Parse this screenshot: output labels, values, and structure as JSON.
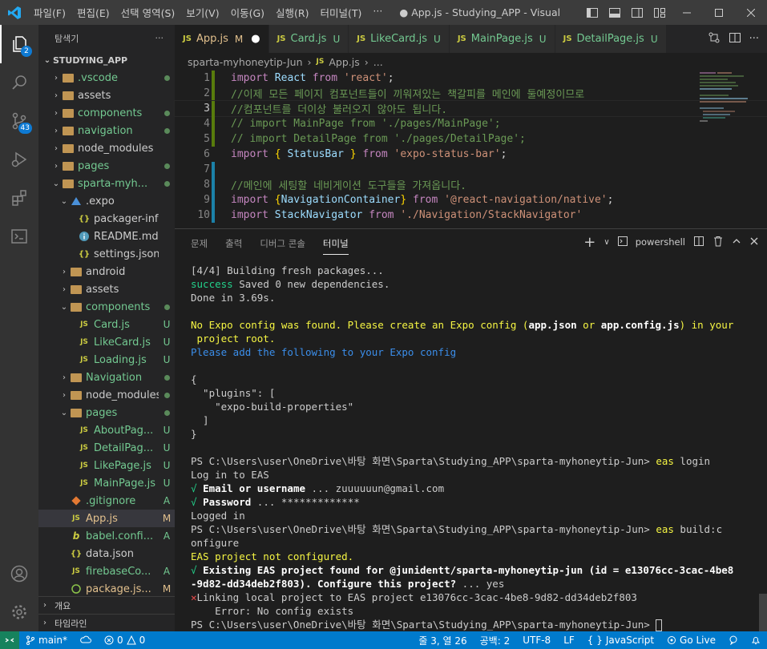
{
  "titlebar": {
    "menu": [
      "파일(F)",
      "편집(E)",
      "선택 영역(S)",
      "보기(V)",
      "이동(G)",
      "실행(R)",
      "터미널(T)",
      "···"
    ],
    "title": "● App.js - Studying_APP - Visual Studi..."
  },
  "activity": {
    "explorer_badge": "2",
    "scm_badge": "43"
  },
  "sidebar": {
    "header": "탐색기",
    "more": "···",
    "project": "STUDYING_APP",
    "items": [
      {
        "label": ".vscode",
        "indent": 1,
        "type": "folder",
        "chev": "›",
        "status": "dot",
        "color": "green"
      },
      {
        "label": "assets",
        "indent": 1,
        "type": "folder",
        "chev": "›",
        "status": "",
        "color": ""
      },
      {
        "label": "components",
        "indent": 1,
        "type": "folder",
        "chev": "›",
        "status": "dot",
        "color": "green"
      },
      {
        "label": "navigation",
        "indent": 1,
        "type": "folder",
        "chev": "›",
        "status": "dot",
        "color": "green"
      },
      {
        "label": "node_modules",
        "indent": 1,
        "type": "folder",
        "chev": "›",
        "status": "",
        "color": ""
      },
      {
        "label": "pages",
        "indent": 1,
        "type": "folder",
        "chev": "›",
        "status": "dot",
        "color": "green"
      },
      {
        "label": "sparta-myh...",
        "indent": 1,
        "type": "folder",
        "chev": "⌄",
        "status": "dot",
        "color": "green"
      },
      {
        "label": ".expo",
        "indent": 2,
        "type": "folder",
        "chev": "⌄",
        "status": "",
        "color": ""
      },
      {
        "label": "packager-info.j...",
        "indent": 3,
        "type": "json",
        "chev": "",
        "status": "",
        "color": ""
      },
      {
        "label": "README.md",
        "indent": 3,
        "type": "info",
        "chev": "",
        "status": "",
        "color": ""
      },
      {
        "label": "settings.json",
        "indent": 3,
        "type": "json",
        "chev": "",
        "status": "",
        "color": ""
      },
      {
        "label": "android",
        "indent": 2,
        "type": "folder",
        "chev": "›",
        "status": "",
        "color": ""
      },
      {
        "label": "assets",
        "indent": 2,
        "type": "folder",
        "chev": "›",
        "status": "",
        "color": ""
      },
      {
        "label": "components",
        "indent": 2,
        "type": "folder",
        "chev": "⌄",
        "status": "dot",
        "color": "green"
      },
      {
        "label": "Card.js",
        "indent": 3,
        "type": "js",
        "chev": "",
        "status": "U",
        "color": "green"
      },
      {
        "label": "LikeCard.js",
        "indent": 3,
        "type": "js",
        "chev": "",
        "status": "U",
        "color": "green"
      },
      {
        "label": "Loading.js",
        "indent": 3,
        "type": "js",
        "chev": "",
        "status": "U",
        "color": "green"
      },
      {
        "label": "Navigation",
        "indent": 2,
        "type": "folder",
        "chev": "›",
        "status": "dot",
        "color": "green"
      },
      {
        "label": "node_modules",
        "indent": 2,
        "type": "folder",
        "chev": "›",
        "status": "dot",
        "color": ""
      },
      {
        "label": "pages",
        "indent": 2,
        "type": "folder",
        "chev": "⌄",
        "status": "dot",
        "color": "green"
      },
      {
        "label": "AboutPag...",
        "indent": 3,
        "type": "js",
        "chev": "",
        "status": "U",
        "color": "green"
      },
      {
        "label": "DetailPag...",
        "indent": 3,
        "type": "js",
        "chev": "",
        "status": "U",
        "color": "green"
      },
      {
        "label": "LikePage.js",
        "indent": 3,
        "type": "js",
        "chev": "",
        "status": "U",
        "color": "green"
      },
      {
        "label": "MainPage.js",
        "indent": 3,
        "type": "js",
        "chev": "",
        "status": "U",
        "color": "green"
      },
      {
        "label": ".gitignore",
        "indent": 2,
        "type": "git",
        "chev": "",
        "status": "A",
        "color": "green"
      },
      {
        "label": "App.js",
        "indent": 2,
        "type": "js",
        "chev": "",
        "status": "M",
        "color": "yellow"
      },
      {
        "label": "babel.confi...",
        "indent": 2,
        "type": "babel",
        "chev": "",
        "status": "A",
        "color": "green"
      },
      {
        "label": "data.json",
        "indent": 2,
        "type": "json",
        "chev": "",
        "status": "",
        "color": ""
      },
      {
        "label": "firebaseCo...",
        "indent": 2,
        "type": "js",
        "chev": "",
        "status": "A",
        "color": "green"
      },
      {
        "label": "package.js...",
        "indent": 2,
        "type": "pkg",
        "chev": "",
        "status": "M",
        "color": "yellow"
      }
    ],
    "outline": "개요",
    "timeline": "타임라인"
  },
  "tabs": [
    {
      "label": "App.js",
      "mark": "M",
      "dirty": "●",
      "active": true
    },
    {
      "label": "Card.js",
      "mark": "U",
      "dirty": "",
      "active": false
    },
    {
      "label": "LikeCard.js",
      "mark": "U",
      "dirty": "",
      "active": false
    },
    {
      "label": "MainPage.js",
      "mark": "U",
      "dirty": "",
      "active": false
    },
    {
      "label": "DetailPage.js",
      "mark": "U",
      "dirty": "",
      "active": false
    }
  ],
  "breadcrumb": {
    "folder": "sparta-myhoneytip-Jun",
    "sep": "›",
    "file": "App.js",
    "tail": "..."
  },
  "code": [
    {
      "n": "1",
      "gutter": "mod",
      "tokens": [
        [
          "kw",
          "import "
        ],
        [
          "var",
          "React "
        ],
        [
          "kw",
          "from "
        ],
        [
          "str",
          "'react'"
        ],
        [
          "pn",
          ";"
        ]
      ]
    },
    {
      "n": "2",
      "gutter": "mod",
      "tokens": [
        [
          "cm",
          "//이제 모든 페이지 컴포넌트들이 끼워져있는 책갈피를 메인에 둘예정이므로"
        ]
      ]
    },
    {
      "n": "3",
      "gutter": "mod",
      "tokens": [
        [
          "cm",
          "//컴포넌트를 더이상 불러오지 않아도 됩니다."
        ]
      ]
    },
    {
      "n": "4",
      "gutter": "mod",
      "tokens": [
        [
          "cm",
          "// import MainPage from './pages/MainPage';"
        ]
      ]
    },
    {
      "n": "5",
      "gutter": "mod",
      "tokens": [
        [
          "cm",
          "// import DetailPage from './pages/DetailPage';"
        ]
      ]
    },
    {
      "n": "6",
      "gutter": "",
      "tokens": [
        [
          "kw",
          "import "
        ],
        [
          "br",
          "{ "
        ],
        [
          "var",
          "StatusBar "
        ],
        [
          "br",
          "} "
        ],
        [
          "kw",
          "from "
        ],
        [
          "str",
          "'expo-status-bar'"
        ],
        [
          "pn",
          ";"
        ]
      ]
    },
    {
      "n": "7",
      "gutter": "add",
      "tokens": []
    },
    {
      "n": "8",
      "gutter": "add",
      "tokens": [
        [
          "cm",
          "//메인에 세팅할 네비게이션 도구들을 가져옵니다."
        ]
      ]
    },
    {
      "n": "9",
      "gutter": "add",
      "tokens": [
        [
          "kw",
          "import "
        ],
        [
          "br",
          "{"
        ],
        [
          "var",
          "NavigationContainer"
        ],
        [
          "br",
          "} "
        ],
        [
          "kw",
          "from "
        ],
        [
          "str",
          "'@react-navigation/native'"
        ],
        [
          "pn",
          ";"
        ]
      ]
    },
    {
      "n": "10",
      "gutter": "add",
      "tokens": [
        [
          "kw",
          "import "
        ],
        [
          "var",
          "StackNavigator "
        ],
        [
          "kw",
          "from "
        ],
        [
          "str",
          "'./Navigation/StackNavigator'"
        ]
      ]
    }
  ],
  "panel": {
    "tabs": [
      "문제",
      "출력",
      "디버그 콘솔",
      "터미널"
    ],
    "active_tab": "터미널",
    "shell": "powershell",
    "add": "+",
    "chevron": "∨"
  },
  "terminal": [
    [
      [
        "",
        "[4/4] Building fresh packages..."
      ]
    ],
    [
      [
        "t-grn",
        "success"
      ],
      [
        "",
        " Saved 0 new dependencies."
      ]
    ],
    [
      [
        "",
        "Done in 3.69s."
      ]
    ],
    [
      [
        "",
        ""
      ]
    ],
    [
      [
        "t-ylw",
        "No Expo config was found. Please create an Expo config ("
      ],
      [
        "t-wht",
        "app.json"
      ],
      [
        "t-ylw",
        " or "
      ],
      [
        "t-wht",
        "app.config.js"
      ],
      [
        "t-ylw",
        ") in your"
      ]
    ],
    [
      [
        "t-ylw",
        " project root."
      ]
    ],
    [
      [
        "t-blu",
        "Please add the following to your Expo config"
      ]
    ],
    [
      [
        "",
        ""
      ]
    ],
    [
      [
        "",
        "{"
      ]
    ],
    [
      [
        "",
        "  \"plugins\": ["
      ]
    ],
    [
      [
        "",
        "    \"expo-build-properties\""
      ]
    ],
    [
      [
        "",
        "  ]"
      ]
    ],
    [
      [
        "",
        "}"
      ]
    ],
    [
      [
        "",
        ""
      ]
    ],
    [
      [
        "",
        "PS C:\\Users\\user\\OneDrive\\바탕 화면\\Sparta\\Studying_APP\\sparta-myhoneytip-Jun> "
      ],
      [
        "t-ylw",
        "eas"
      ],
      [
        "",
        " login"
      ]
    ],
    [
      [
        "",
        "Log in to EAS"
      ]
    ],
    [
      [
        "t-grn",
        "√ "
      ],
      [
        "t-wht",
        "Email or username"
      ],
      [
        "",
        " ... zuuuuuun@gmail.com"
      ]
    ],
    [
      [
        "t-grn",
        "√ "
      ],
      [
        "t-wht",
        "Password"
      ],
      [
        "",
        " ... *************"
      ]
    ],
    [
      [
        "",
        "Logged in"
      ]
    ],
    [
      [
        "",
        "PS C:\\Users\\user\\OneDrive\\바탕 화면\\Sparta\\Studying_APP\\sparta-myhoneytip-Jun> "
      ],
      [
        "t-ylw",
        "eas"
      ],
      [
        "",
        " build:c"
      ]
    ],
    [
      [
        "",
        "onfigure"
      ]
    ],
    [
      [
        "t-ylw",
        "EAS project not configured."
      ]
    ],
    [
      [
        "t-grn",
        "√ "
      ],
      [
        "t-wht",
        "Existing EAS project found for @junidentt/sparta-myhoneytip-jun (id = e13076cc-3cac-4be8"
      ]
    ],
    [
      [
        "t-wht",
        "-9d82-dd34deb2f803). Configure this project?"
      ],
      [
        "",
        " ... yes"
      ]
    ],
    [
      [
        "t-red",
        "✕"
      ],
      [
        "",
        "Linking local project to EAS project e13076cc-3cac-4be8-9d82-dd34deb2f803"
      ]
    ],
    [
      [
        "",
        "    Error: No config exists"
      ]
    ],
    [
      [
        "",
        "PS C:\\Users\\user\\OneDrive\\바탕 화면\\Sparta\\Studying_APP\\sparta-myhoneytip-Jun> "
      ]
    ]
  ],
  "statusbar": {
    "branch": "main*",
    "errors": "0",
    "warnings": "0",
    "position": "줄 3, 열 26",
    "spaces": "공백: 2",
    "encoding": "UTF-8",
    "eol": "LF",
    "lang_icon": "{ }",
    "language": "JavaScript",
    "golive": "Go Live"
  },
  "colors": {
    "accent": "#007acc",
    "modified": "#e2c08d",
    "untracked": "#73c991"
  }
}
